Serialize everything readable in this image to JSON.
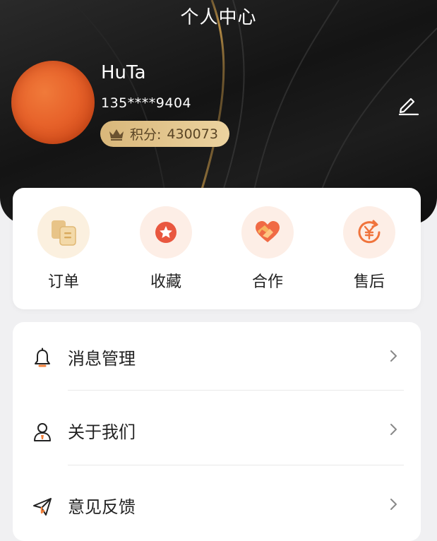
{
  "header": {
    "title": "个人中心",
    "username": "HuTa",
    "phone": "135****9404",
    "points_label": "积分:",
    "points_value": "430073"
  },
  "quick_actions": [
    {
      "label": "订单",
      "icon": "order-icon"
    },
    {
      "label": "收藏",
      "icon": "favorite-star-icon"
    },
    {
      "label": "合作",
      "icon": "handshake-heart-icon"
    },
    {
      "label": "售后",
      "icon": "yen-refund-icon"
    }
  ],
  "menu": [
    {
      "label": "消息管理",
      "icon": "bell-icon"
    },
    {
      "label": "关于我们",
      "icon": "person-icon"
    },
    {
      "label": "意见反馈",
      "icon": "paper-plane-icon"
    }
  ],
  "colors": {
    "accent_orange": "#f2803b",
    "header_dark": "#141414",
    "gold": "#e2c48c"
  }
}
